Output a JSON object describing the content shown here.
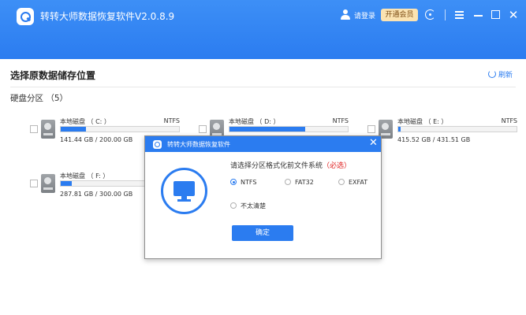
{
  "app": {
    "title": "转转大师数据恢复软件V2.0.8.9",
    "login_label": "请登录",
    "vip_label": "开通会员",
    "accent_color": "#2b7cf0"
  },
  "icons": {
    "logo": "app-logo-icon",
    "user": "user-icon",
    "refresh_circle": "refresh-icon",
    "menu": "menu-icon",
    "minimize": "minimize-icon",
    "maximize": "maximize-icon",
    "close": "close-icon",
    "close_glyph": "✕",
    "dialog_close_glyph": "✕"
  },
  "main": {
    "section_title": "选择原数据储存位置",
    "refresh_label": "刷新",
    "disk_heading": "硬盘分区 （5）",
    "partitions": [
      {
        "name": "本地磁盘 （ C: ）",
        "fs": "NTFS",
        "size": "141.44 GB / 200.00 GB",
        "used_fraction": 0.21
      },
      {
        "name": "本地磁盘 （ D: ）",
        "fs": "NTFS",
        "size": "",
        "used_fraction": 0.64
      },
      {
        "name": "本地磁盘 （ E: ）",
        "fs": "NTFS",
        "size": "415.52 GB / 431.51 GB",
        "used_fraction": 0.02
      },
      {
        "name": "本地磁盘 （ F: ）",
        "fs": "",
        "size": "287.81 GB / 300.00 GB",
        "used_fraction": 0.09
      }
    ]
  },
  "dialog": {
    "title": "转转大师数据恢复软件",
    "prompt": "请选择分区格式化前文件系统",
    "required": "（必选）",
    "options": [
      {
        "label": "NTFS",
        "checked": true
      },
      {
        "label": "FAT32",
        "checked": false
      },
      {
        "label": "EXFAT",
        "checked": false
      },
      {
        "label": "不太清楚",
        "checked": false
      }
    ],
    "confirm_label": "确定"
  }
}
